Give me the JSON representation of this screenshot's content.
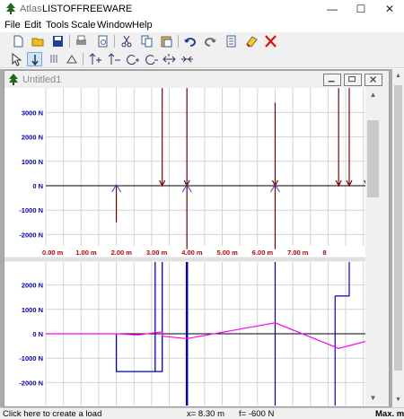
{
  "window": {
    "app_name": "Atlas",
    "doc_name": "LISTOFFREEWARE"
  },
  "menu": [
    "File",
    "Edit",
    "Tools",
    "Scale",
    "Window",
    "Help"
  ],
  "child": {
    "title": "Untitled1"
  },
  "colors": {
    "force": "#800000",
    "shear": "#0000cc",
    "moment": "#ff00ff",
    "axis_label": "#0000cc",
    "x_label": "#cc0000"
  },
  "top_plot": {
    "y_ticks": [
      {
        "label": "3000 N",
        "value": 3000
      },
      {
        "label": "2000 N",
        "value": 2000
      },
      {
        "label": "1000 N",
        "value": 1000
      },
      {
        "label": "0 N",
        "value": 0
      },
      {
        "label": "-1000 N",
        "value": -1000
      },
      {
        "label": "-2000 N",
        "value": -2000
      }
    ],
    "x_ticks": [
      {
        "label": "0.00 m",
        "value": 0
      },
      {
        "label": "1.00 m",
        "value": 1
      },
      {
        "label": "2.00 m",
        "value": 2
      },
      {
        "label": "3.00 m",
        "value": 3
      },
      {
        "label": "4.00 m",
        "value": 4
      },
      {
        "label": "5.00 m",
        "value": 5
      },
      {
        "label": "6.00 m",
        "value": 6
      },
      {
        "label": "7.00 m",
        "value": 7
      },
      {
        "label": "8",
        "value": 8
      }
    ],
    "supports": [
      2.0,
      4.0,
      6.5,
      9.5
    ],
    "down_loads": [
      {
        "x": 3.3,
        "magnitude": 4000
      },
      {
        "x": 4.0,
        "magnitude": 4000
      },
      {
        "x": 6.5,
        "magnitude": 3400
      },
      {
        "x": 8.3,
        "magnitude": 4000
      },
      {
        "x": 8.6,
        "magnitude": 4000
      },
      {
        "x": 9.1,
        "magnitude": 4000
      }
    ],
    "reactions": [
      {
        "x": 2.0,
        "magnitude": -1500
      },
      {
        "x": 4.0,
        "magnitude": -2600
      },
      {
        "x": 6.5,
        "magnitude": -2600
      },
      {
        "x": 9.5,
        "magnitude": -2600
      }
    ]
  },
  "bottom_plot": {
    "y_ticks": [
      {
        "label": "2000 N",
        "value": 2000
      },
      {
        "label": "1000 N",
        "value": 1000
      },
      {
        "label": "0 N",
        "value": 0
      },
      {
        "label": "-1000 N",
        "value": -1000
      },
      {
        "label": "-2000 N",
        "value": -2000
      }
    ],
    "shear": [
      [
        2.0,
        0
      ],
      [
        2.0,
        -1550
      ],
      [
        3.1,
        -1550
      ],
      [
        3.1,
        3000
      ],
      [
        3.3,
        3000
      ],
      [
        3.3,
        -1550
      ],
      [
        3.1,
        -1550
      ]
    ],
    "shear_lines": [
      {
        "x": 4.0,
        "from": 3000,
        "to": -3000,
        "bold": true
      },
      {
        "x": 6.5,
        "from": 3000,
        "to": -3000,
        "bold": false
      },
      {
        "x": 8.2,
        "from": -3000,
        "to": 1550,
        "bold": false
      }
    ],
    "shear_step": [
      [
        8.2,
        1550
      ],
      [
        8.6,
        1550
      ],
      [
        8.6,
        3000
      ]
    ],
    "moment": [
      [
        0,
        0
      ],
      [
        2.0,
        0
      ],
      [
        2.6,
        -50
      ],
      [
        3.3,
        80
      ],
      [
        3.3,
        -100
      ],
      [
        4.0,
        -200
      ],
      [
        6.5,
        450
      ],
      [
        8.3,
        -600
      ],
      [
        9.1,
        -300
      ],
      [
        9.7,
        350
      ],
      [
        10.5,
        450
      ]
    ]
  },
  "status": {
    "hint": "Click here to create a load",
    "x_readout": "x=  8.30 m",
    "f_readout": "f=  -600 N",
    "right": "Max. mo"
  }
}
